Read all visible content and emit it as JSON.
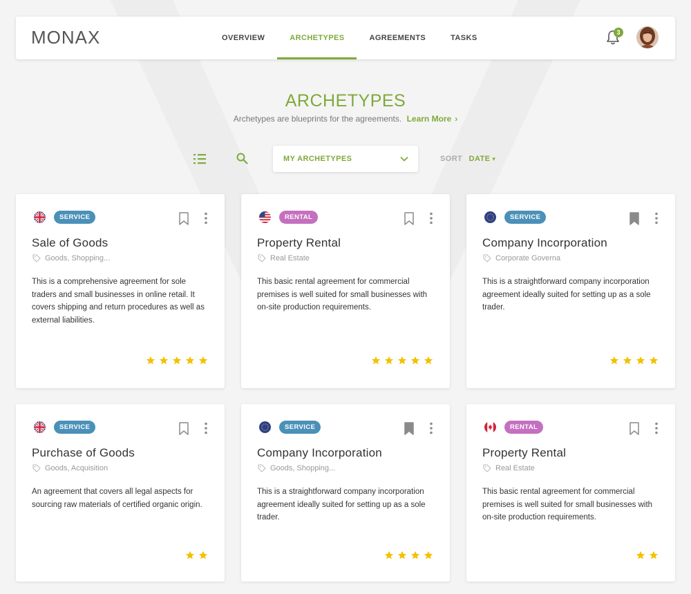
{
  "app": {
    "logo": "MONAX"
  },
  "nav": {
    "items": [
      {
        "label": "OVERVIEW",
        "active": false
      },
      {
        "label": "ARCHETYPES",
        "active": true
      },
      {
        "label": "AGREEMENTS",
        "active": false
      },
      {
        "label": "TASKS",
        "active": false
      }
    ],
    "notification_count": "3"
  },
  "page": {
    "title": "ARCHETYPES",
    "subtitle": "Archetypes are blueprints for the agreements.",
    "learn_more": "Learn More"
  },
  "toolbar": {
    "filter_value": "MY ARCHETYPES",
    "sort_label": "SORT",
    "sort_value": "DATE"
  },
  "colors": {
    "accent": "#7fa93a",
    "service": "#4a90b8",
    "rental": "#c56fc0",
    "star": "#f2c200"
  },
  "cards": [
    {
      "flag": "uk-flag-icon",
      "category": "SERVICE",
      "bookmarked": false,
      "title": "Sale of Goods",
      "tags": "Goods, Shopping...",
      "description": "This is a comprehensive agreement for sole traders and small businesses in online retail. It covers shipping and return procedures as well as external liabilities.",
      "rating": 5
    },
    {
      "flag": "us-flag-icon",
      "category": "RENTAL",
      "bookmarked": false,
      "title": "Property Rental",
      "tags": "Real Estate",
      "description": "This basic rental agreement for commercial premises is well suited for small businesses with on-site production requirements.",
      "rating": 5
    },
    {
      "flag": "eu-flag-icon",
      "category": "SERVICE",
      "bookmarked": true,
      "title": "Company Incorporation",
      "tags": "Corporate Governa",
      "description": "This is a straightforward company incorporation agreement ideally suited for setting up as a sole trader.",
      "rating": 4
    },
    {
      "flag": "uk-flag-icon",
      "category": "SERVICE",
      "bookmarked": false,
      "title": "Purchase of Goods",
      "tags": "Goods, Acquisition",
      "description": "An agreement that covers all legal aspects for sourcing raw materials of certified organic origin.",
      "rating": 2
    },
    {
      "flag": "eu-flag-icon",
      "category": "SERVICE",
      "bookmarked": true,
      "title": "Company Incorporation",
      "tags": "Goods, Shopping...",
      "description": "This is a straightforward company incorporation agreement ideally suited for setting up as a sole trader.",
      "rating": 4
    },
    {
      "flag": "canada-flag-icon",
      "category": "RENTAL",
      "bookmarked": false,
      "title": "Property Rental",
      "tags": "Real Estate",
      "description": "This basic rental agreement for commercial premises is well suited for small businesses with on-site production requirements.",
      "rating": 2
    }
  ]
}
